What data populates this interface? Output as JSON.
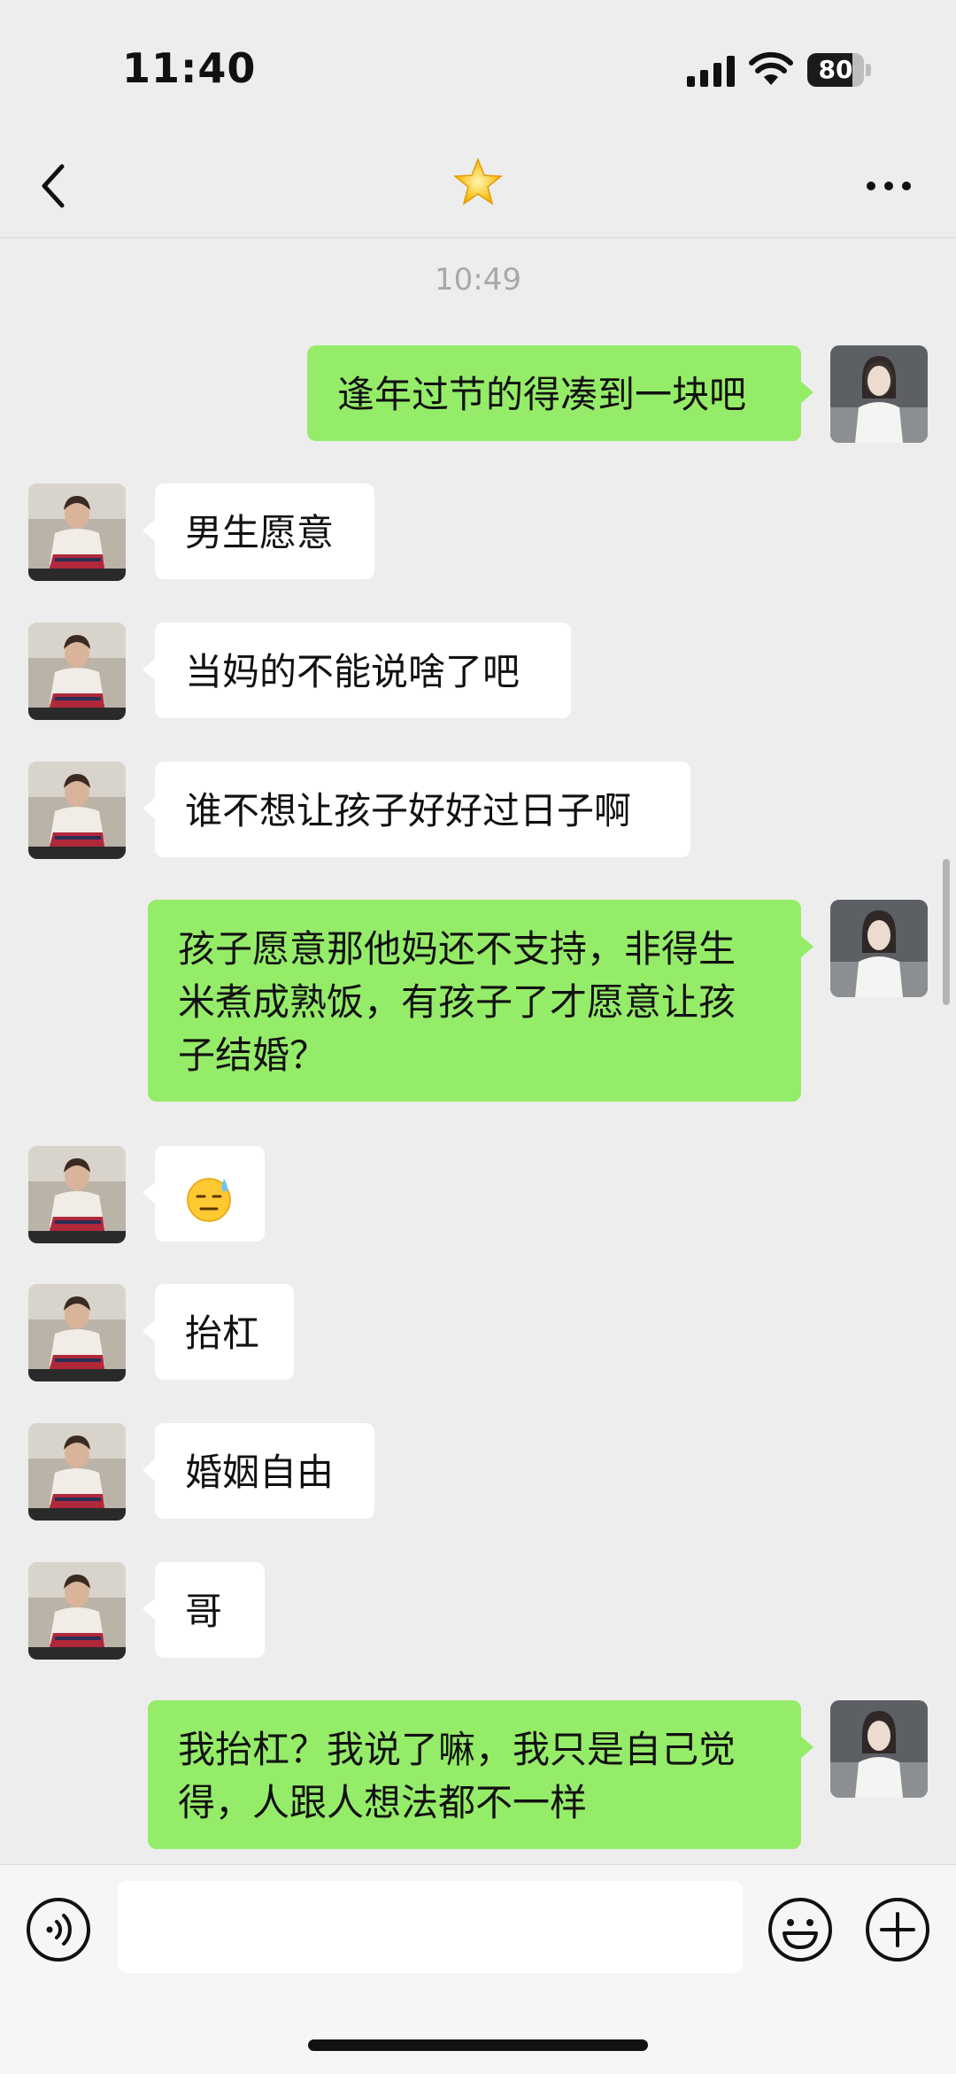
{
  "status_bar": {
    "time": "11:40",
    "battery_percent": 80,
    "battery_label": "80"
  },
  "nav": {
    "title_icon": "star-emoji",
    "back_icon": "chevron-left-icon",
    "more_icon": "more-icon"
  },
  "chat": {
    "timestamp": "10:49",
    "messages": [
      {
        "side": "right",
        "text": "逢年过节的得凑到一块吧"
      },
      {
        "side": "left",
        "text": "男生愿意"
      },
      {
        "side": "left",
        "text": "当妈的不能说啥了吧"
      },
      {
        "side": "left",
        "text": "谁不想让孩子好好过日子啊"
      },
      {
        "side": "right",
        "text": "孩子愿意那他妈还不支持，非得生米煮成熟饭，有孩子了才愿意让孩子结婚？"
      },
      {
        "side": "left",
        "text": "",
        "emoji": "sweat-smile-emoji"
      },
      {
        "side": "left",
        "text": "抬杠"
      },
      {
        "side": "left",
        "text": "婚姻自由"
      },
      {
        "side": "left",
        "text": "哥"
      },
      {
        "side": "right",
        "text": "我抬杠？我说了嘛，我只是自己觉得，人跟人想法都不一样"
      }
    ]
  },
  "input_bar": {
    "placeholder": "",
    "voice_icon": "voice-icon",
    "emoji_icon": "emoji-icon",
    "plus_icon": "plus-icon"
  },
  "colors": {
    "background": "#ededed",
    "sent_bubble": "#95ec69",
    "received_bubble": "#ffffff"
  }
}
